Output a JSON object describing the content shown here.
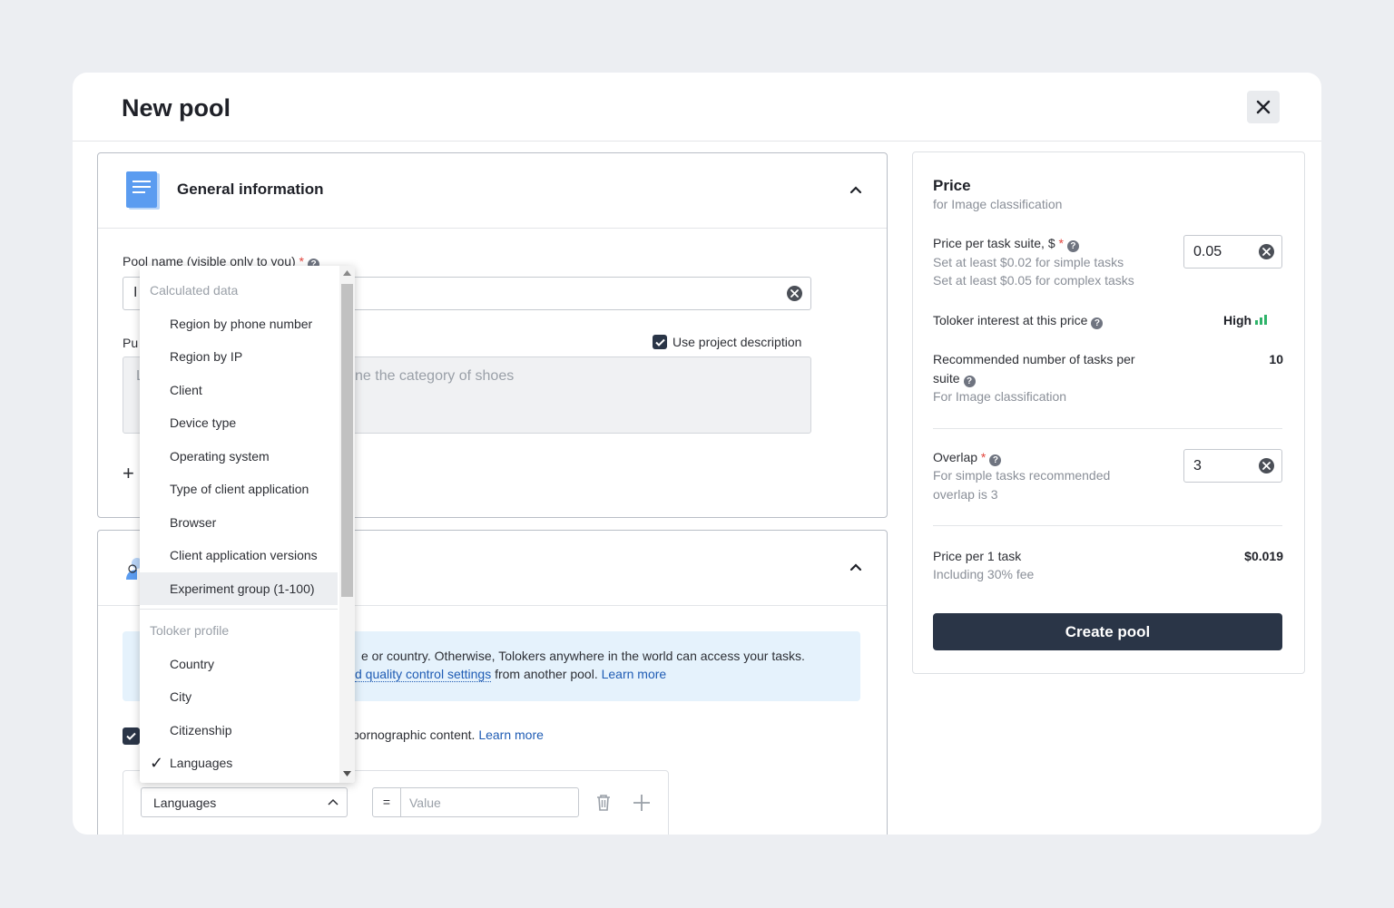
{
  "modal": {
    "title": "New pool"
  },
  "general": {
    "title": "General information",
    "pool_name_label": "Pool name (visible only to you)",
    "pool_name_value_fragment": "I",
    "public_label_fragment": "Pu",
    "use_project_description": "Use project description",
    "textarea_left_fragment": "L",
    "textarea_text_fragment": "ne the category of shoes",
    "add_symbol": "+"
  },
  "audience": {
    "info_line1": "e or country. Otherwise, Tolokers anywhere in the world can access your tasks.",
    "info_line2_link": "d quality control settings",
    "info_line2_text": " from another pool. ",
    "learn_more": "Learn more",
    "adult_text": "pornographic content. ",
    "adult_link": "Learn more",
    "filter_field": "Languages",
    "filter_operator": "=",
    "filter_value_placeholder": "Value"
  },
  "dropdown": {
    "groups": [
      {
        "label": "Calculated data",
        "items": [
          {
            "label": "Region by phone number"
          },
          {
            "label": "Region by IP"
          },
          {
            "label": "Client"
          },
          {
            "label": "Device type"
          },
          {
            "label": "Operating system"
          },
          {
            "label": "Type of client application"
          },
          {
            "label": "Browser"
          },
          {
            "label": "Client application versions"
          },
          {
            "label": "Experiment group (1-100)"
          }
        ]
      },
      {
        "label": "Toloker profile",
        "items": [
          {
            "label": "Country"
          },
          {
            "label": "City"
          },
          {
            "label": "Citizenship"
          },
          {
            "label": "Languages"
          }
        ]
      }
    ],
    "checkmark": "✓"
  },
  "price": {
    "title": "Price",
    "subtitle": "for Image classification",
    "per_suite_label": "Price per task suite, $",
    "per_suite_hint1": "Set at least $0.02 for simple tasks",
    "per_suite_hint2": "Set at least $0.05 for complex tasks",
    "per_suite_value": "0.05",
    "interest_label": "Toloker interest at this price",
    "interest_value": "High",
    "recommended_label1": "Recommended number of tasks per",
    "recommended_label2": "suite",
    "recommended_sub": "For Image classification",
    "recommended_value": "10",
    "overlap_label": "Overlap",
    "overlap_hint1": "For simple tasks recommended",
    "overlap_hint2": "overlap is 3",
    "overlap_value": "3",
    "per_task_label": "Price per 1 task",
    "per_task_sub": "Including 30% fee",
    "per_task_value": "$0.019",
    "create_button": "Create pool"
  },
  "colors": {
    "primary": "#2a3547",
    "accent_green": "#2fb36a",
    "link": "#1f5cb4",
    "info_bg": "#e5f2fc"
  }
}
